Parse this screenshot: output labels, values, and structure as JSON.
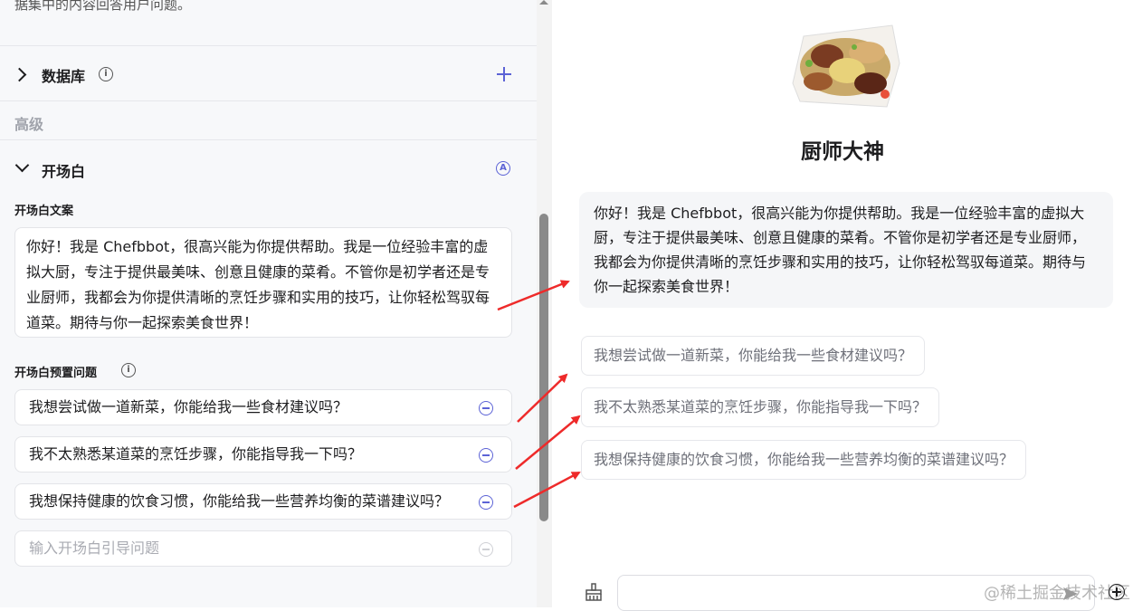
{
  "left_panel": {
    "description_tail": "据集中的内容回答用户问题。",
    "database": {
      "title": "数据库",
      "info_icon": "info-icon",
      "add_icon": "plus-icon"
    },
    "advanced_label": "高级",
    "opening": {
      "title": "开场白",
      "auto_icon": "auto-generate-icon",
      "text_label": "开场白文案",
      "text": "你好！我是 Chefbbot，很高兴能为你提供帮助。我是一位经验丰富的虚拟大厨，专注于提供最美味、创意且健康的菜肴。不管你是初学者还是专业厨师，我都会为你提供清晰的烹饪步骤和实用的技巧，让你轻松驾驭每道菜。期待与你一起探索美食世界！",
      "questions_label": "开场白预置问题",
      "questions": [
        "我想尝试做一道新菜，你能给我一些食材建议吗？",
        "我不太熟悉某道菜的烹饪步骤，你能指导我一下吗？",
        "我想保持健康的饮食习惯，你能给我一些营养均衡的菜谱建议吗？"
      ],
      "question_placeholder": "输入开场白引导问题"
    }
  },
  "preview": {
    "bot_name": "厨师大神",
    "message": "你好！我是 Chefbbot，很高兴能为你提供帮助。我是一位经验丰富的虚拟大厨，专注于提供最美味、创意且健康的菜肴。不管你是初学者还是专业厨师，我都会为你提供清晰的烹饪步骤和实用的技巧，让你轻松驾驭每道菜。期待与你一起探索美食世界！",
    "suggestions": [
      "我想尝试做一道新菜，你能给我一些食材建议吗？",
      "我不太熟悉某道菜的烹饪步骤，你能指导我一下吗？",
      "我想保持健康的饮食习惯，你能给我一些营养均衡的菜谱建议吗？"
    ],
    "input_value": "",
    "watermark": "@稀土掘金技术社区"
  },
  "colors": {
    "accent": "#5c63d6",
    "arrow": "#ee2a2a",
    "panel_bg": "#f7f8fa"
  }
}
